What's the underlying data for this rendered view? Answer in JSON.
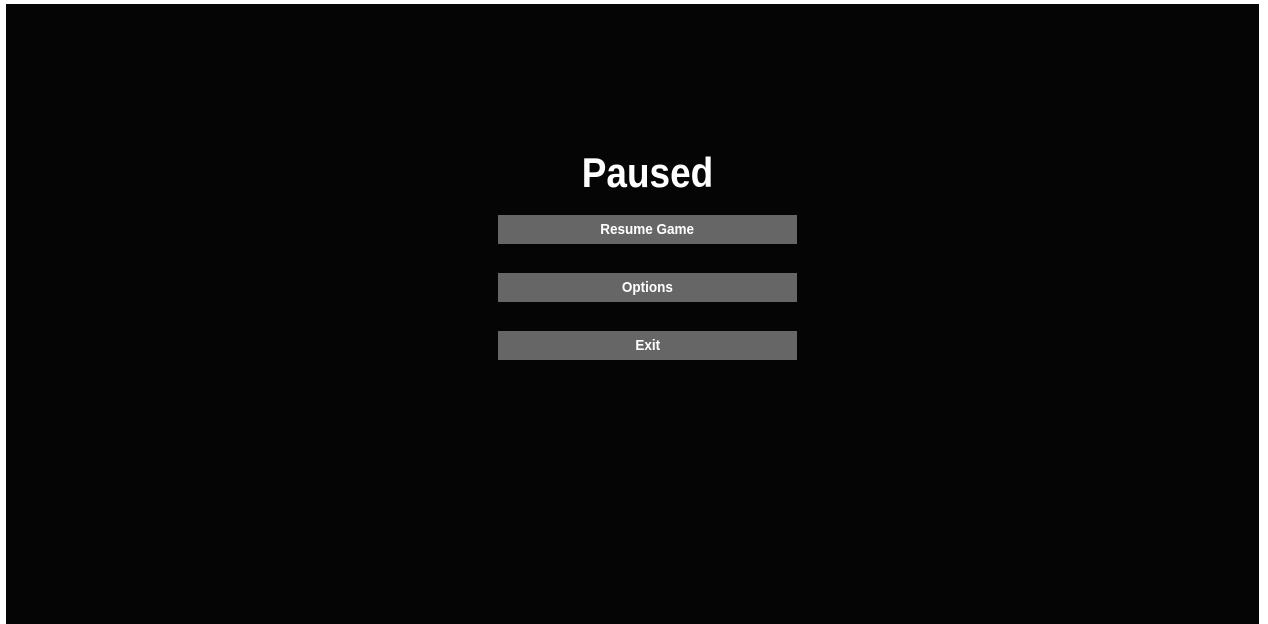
{
  "pause_menu": {
    "title": "Paused",
    "buttons": [
      {
        "label": "Resume Game"
      },
      {
        "label": "Options"
      },
      {
        "label": "Exit"
      }
    ]
  },
  "colors": {
    "background": "#050505",
    "button_fill": "#666666",
    "text": "#ffffff",
    "page_border": "#ffffff"
  }
}
